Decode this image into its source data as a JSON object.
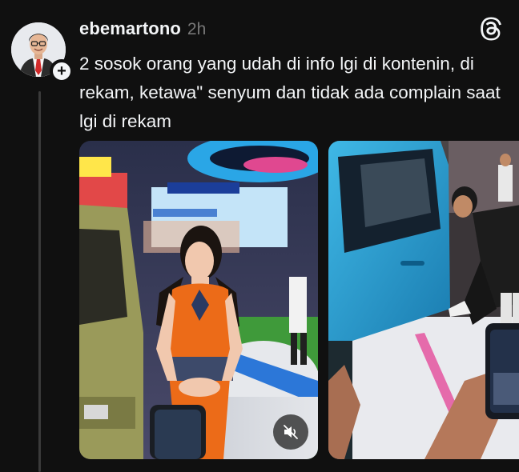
{
  "post": {
    "username": "ebemartono",
    "timestamp": "2h",
    "text": "2 sosok orang yang udah di info lgi di kontenin, di rekam, ketawa\" senyum dan tidak ada complain saat lgi di rekam",
    "follow_symbol": "+"
  },
  "icons": {
    "app_logo": "threads-logo-icon",
    "mute": "speaker-muted-icon",
    "follow": "plus-icon"
  },
  "colors": {
    "background": "#101010",
    "text_primary": "#f3f5f7",
    "text_secondary": "#777777",
    "thread_line": "#3a3a3a"
  }
}
